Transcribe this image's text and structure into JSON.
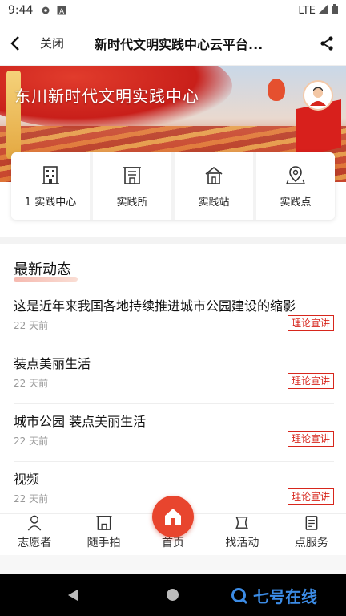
{
  "status": {
    "time": "9:44",
    "network": "LTE"
  },
  "nav": {
    "close_label": "关闭",
    "title": "新时代文明实践中心云平台..."
  },
  "banner": {
    "title": "东川新时代文明实践中心"
  },
  "categories": [
    {
      "label": "1 实践中心",
      "icon": "building-icon"
    },
    {
      "label": "实践所",
      "icon": "office-icon"
    },
    {
      "label": "实践站",
      "icon": "house-icon"
    },
    {
      "label": "实践点",
      "icon": "map-pin-icon"
    }
  ],
  "news": {
    "title": "最新动态",
    "items": [
      {
        "title": "这是近年来我国各地持续推进城市公园建设的缩影",
        "time": "22 天前",
        "tag": "理论宣讲"
      },
      {
        "title": "装点美丽生活",
        "time": "22 天前",
        "tag": "理论宣讲"
      },
      {
        "title": "城市公园 装点美丽生活",
        "time": "22 天前",
        "tag": "理论宣讲"
      },
      {
        "title": "视频",
        "time": "22 天前",
        "tag": "理论宣讲"
      }
    ]
  },
  "tabs": [
    {
      "label": "志愿者",
      "icon": "volunteer-icon"
    },
    {
      "label": "随手拍",
      "icon": "camera-icon"
    },
    {
      "label": "首页",
      "icon": "home-icon"
    },
    {
      "label": "找活动",
      "icon": "activity-icon"
    },
    {
      "label": "点服务",
      "icon": "service-icon"
    }
  ],
  "watermark": "七号在线",
  "colors": {
    "accent": "#d7261c",
    "home": "#e8452e"
  }
}
